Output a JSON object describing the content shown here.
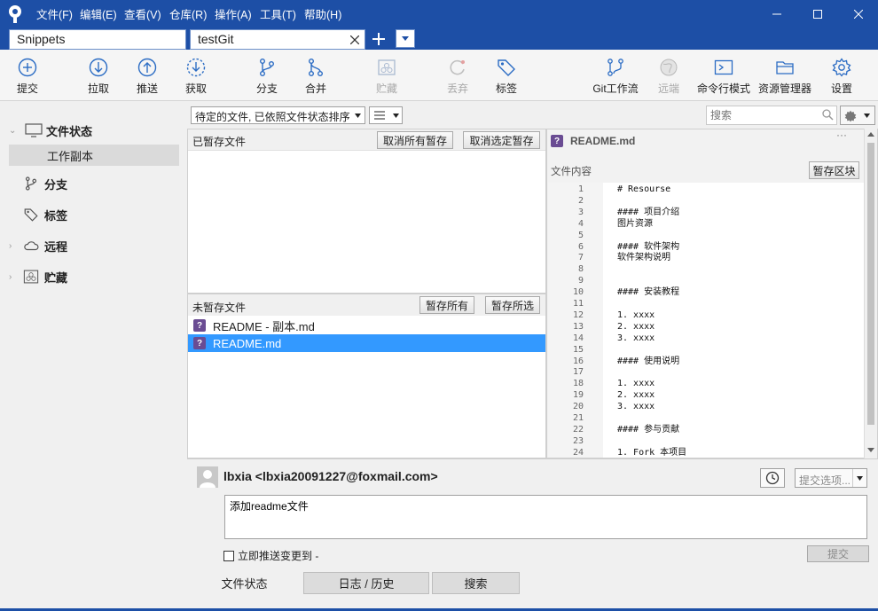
{
  "menu": [
    "文件(F)",
    "编辑(E)",
    "查看(V)",
    "仓库(R)",
    "操作(A)",
    "工具(T)",
    "帮助(H)"
  ],
  "tabs": [
    "Snippets",
    "testGit"
  ],
  "toolbar": {
    "commit": "提交",
    "pull": "拉取",
    "push": "推送",
    "fetch": "获取",
    "branch": "分支",
    "merge": "合并",
    "stash": "贮藏",
    "discard": "丢弃",
    "tag": "标签",
    "gitflow": "Git工作流",
    "remote": "远端",
    "terminal": "命令行模式",
    "explorer": "资源管理器",
    "settings": "设置"
  },
  "sidebar": {
    "file_status": "文件状态",
    "working_copy": "工作副本",
    "branches": "分支",
    "tags": "标签",
    "remotes": "远程",
    "stashes": "贮藏"
  },
  "filter": {
    "sort_select": "待定的文件, 已依照文件状态排序",
    "search_placeholder": "搜索"
  },
  "staged": {
    "title": "已暂存文件",
    "unstage_all": "取消所有暂存",
    "unstage_selected": "取消选定暂存"
  },
  "unstaged": {
    "title": "未暂存文件",
    "stage_all": "暂存所有",
    "stage_selected": "暂存所选",
    "files": [
      {
        "name": "README - 副本.md",
        "selected": false
      },
      {
        "name": "README.md",
        "selected": true
      }
    ]
  },
  "diff": {
    "filename": "README.md",
    "content_label": "文件内容",
    "stage_hunk": "暂存区块",
    "lines": [
      {
        "n": "1",
        "t": "# Resourse"
      },
      {
        "n": "2",
        "t": ""
      },
      {
        "n": "3",
        "t": "#### 项目介绍"
      },
      {
        "n": "4",
        "t": "图片资源"
      },
      {
        "n": "5",
        "t": ""
      },
      {
        "n": "6",
        "t": "#### 软件架构"
      },
      {
        "n": "7",
        "t": "软件架构说明"
      },
      {
        "n": "8",
        "t": ""
      },
      {
        "n": "9",
        "t": ""
      },
      {
        "n": "10",
        "t": "#### 安装教程"
      },
      {
        "n": "11",
        "t": ""
      },
      {
        "n": "12",
        "t": "1. xxxx"
      },
      {
        "n": "13",
        "t": "2. xxxx"
      },
      {
        "n": "14",
        "t": "3. xxxx"
      },
      {
        "n": "15",
        "t": ""
      },
      {
        "n": "16",
        "t": "#### 使用说明"
      },
      {
        "n": "17",
        "t": ""
      },
      {
        "n": "18",
        "t": "1. xxxx"
      },
      {
        "n": "19",
        "t": "2. xxxx"
      },
      {
        "n": "20",
        "t": "3. xxxx"
      },
      {
        "n": "21",
        "t": ""
      },
      {
        "n": "22",
        "t": "#### 参与贡献"
      },
      {
        "n": "23",
        "t": ""
      },
      {
        "n": "24",
        "t": "1. Fork 本项目"
      }
    ]
  },
  "commit": {
    "author": "lbxia <lbxia20091227@foxmail.com>",
    "message": "添加readme文件",
    "options": "提交选项...",
    "push_immediately": "立即推送变更到 -",
    "commit_button": "提交"
  },
  "bottom_tabs": [
    "文件状态",
    "日志 / 历史",
    "搜索"
  ],
  "colors": {
    "titlebar": "#1d4fa6",
    "selection": "#3399ff",
    "question_icon": "#6a4c93"
  }
}
